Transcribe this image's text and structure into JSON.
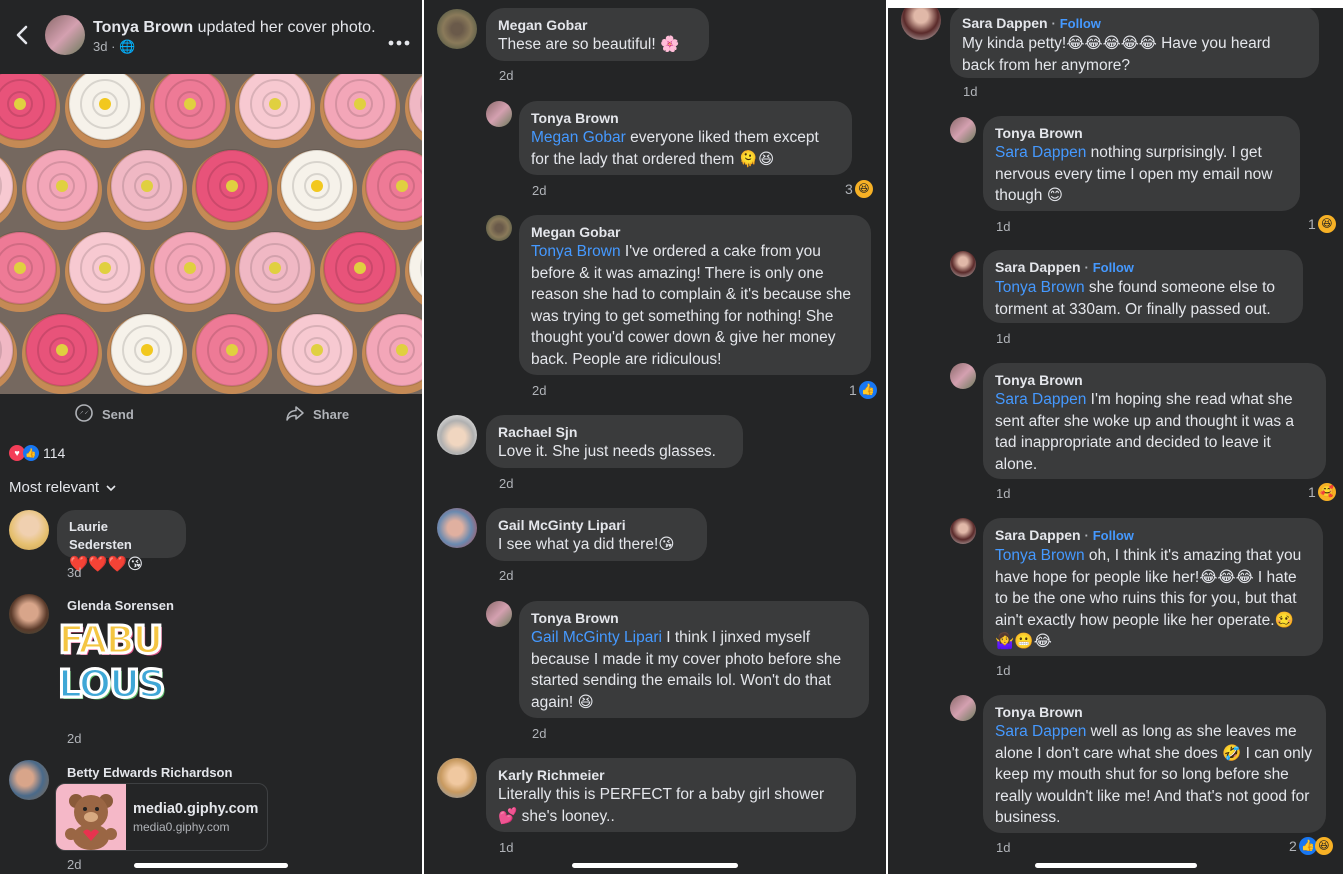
{
  "panel1": {
    "header": {
      "name": "Tonya Brown",
      "action": "updated her cover photo.",
      "time": "3d · 🌐"
    },
    "actions": {
      "send": "Send",
      "share": "Share"
    },
    "reaction_count": "114",
    "sort_label": "Most relevant",
    "comments": [
      {
        "name": "Laurie Sedersten",
        "text": "❤️❤️❤️😘",
        "time": "3d"
      },
      {
        "name": "Glenda Sorensen",
        "sticker_line1": "FABU",
        "sticker_line2": "LOUS",
        "time": "2d"
      },
      {
        "name": "Betty Edwards Richardson",
        "link_title": "media0.giphy.com",
        "link_url": "media0.giphy.com",
        "time": "2d"
      }
    ]
  },
  "panel2": {
    "comments": [
      {
        "name": "Megan Gobar",
        "text": "These are so beautiful! 🌸",
        "time": "2d"
      },
      {
        "name": "Tonya Brown",
        "mention": "Megan Gobar",
        "text": " everyone liked them except for the lady that ordered them 🫠😆",
        "time": "2d",
        "reactions": "3"
      },
      {
        "name": "Megan Gobar",
        "mention": "Tonya Brown",
        "text": " I've ordered a cake from you before & it was amazing!  There is only one reason she had to complain & it's because she was trying to get something for nothing! She thought you'd cower down & give her money back.  People are ridiculous!",
        "time": "2d",
        "reactions": "1"
      },
      {
        "name": "Rachael Sjn",
        "text": "Love it. She just needs glasses.",
        "time": "2d"
      },
      {
        "name": "Gail McGinty Lipari",
        "text": "I see what ya did there!😘",
        "time": "2d"
      },
      {
        "name": "Tonya Brown",
        "mention": "Gail McGinty Lipari",
        "text": " I think I jinxed myself because I made it my cover photo before she started sending the emails lol. Won't do that again! 😆",
        "time": "2d"
      },
      {
        "name": "Karly Richmeier",
        "text": "Literally this is PERFECT for a baby girl shower 💕 she's looney..",
        "time": "1d"
      }
    ]
  },
  "panel3": {
    "follow_label": "Follow",
    "comments": [
      {
        "name": "Sara Dappen",
        "follow": true,
        "text": "My kinda petty!😂😂😂😂😂  Have you heard back from her anymore?",
        "time": "1d"
      },
      {
        "name": "Tonya Brown",
        "mention": "Sara Dappen",
        "text": " nothing surprisingly. I get nervous every time I open my email now though 😊",
        "time": "1d",
        "reactions": "1"
      },
      {
        "name": "Sara Dappen",
        "follow": true,
        "mention": "Tonya Brown",
        "text": " she found someone else to torment at 330am. Or finally passed out.",
        "time": "1d"
      },
      {
        "name": "Tonya Brown",
        "mention": "Sara Dappen",
        "text": " I'm hoping she read what she sent after she woke up and thought it was a tad inappropriate and decided to leave it alone.",
        "time": "1d",
        "reactions": "1"
      },
      {
        "name": "Sara Dappen",
        "follow": true,
        "mention": "Tonya Brown",
        "text": " oh, I think it's amazing that you have hope for people like her!😂😂😂  I hate to be the one who ruins this for you, but that ain't exactly how people like her operate.🥴🤷‍♀️😬😂",
        "time": "1d"
      },
      {
        "name": "Tonya Brown",
        "mention": "Sara Dappen",
        "text": " well as long as she leaves me alone I don't care what she does 🤣  I can only keep my mouth shut for so long before she really wouldn't like me! And that's not good for business.",
        "time": "1d",
        "reactions": "2"
      }
    ]
  },
  "colors": {
    "background": "#242526",
    "bubble": "#3a3b3c",
    "mention": "#4599ff",
    "muted": "#b0b3b8"
  }
}
